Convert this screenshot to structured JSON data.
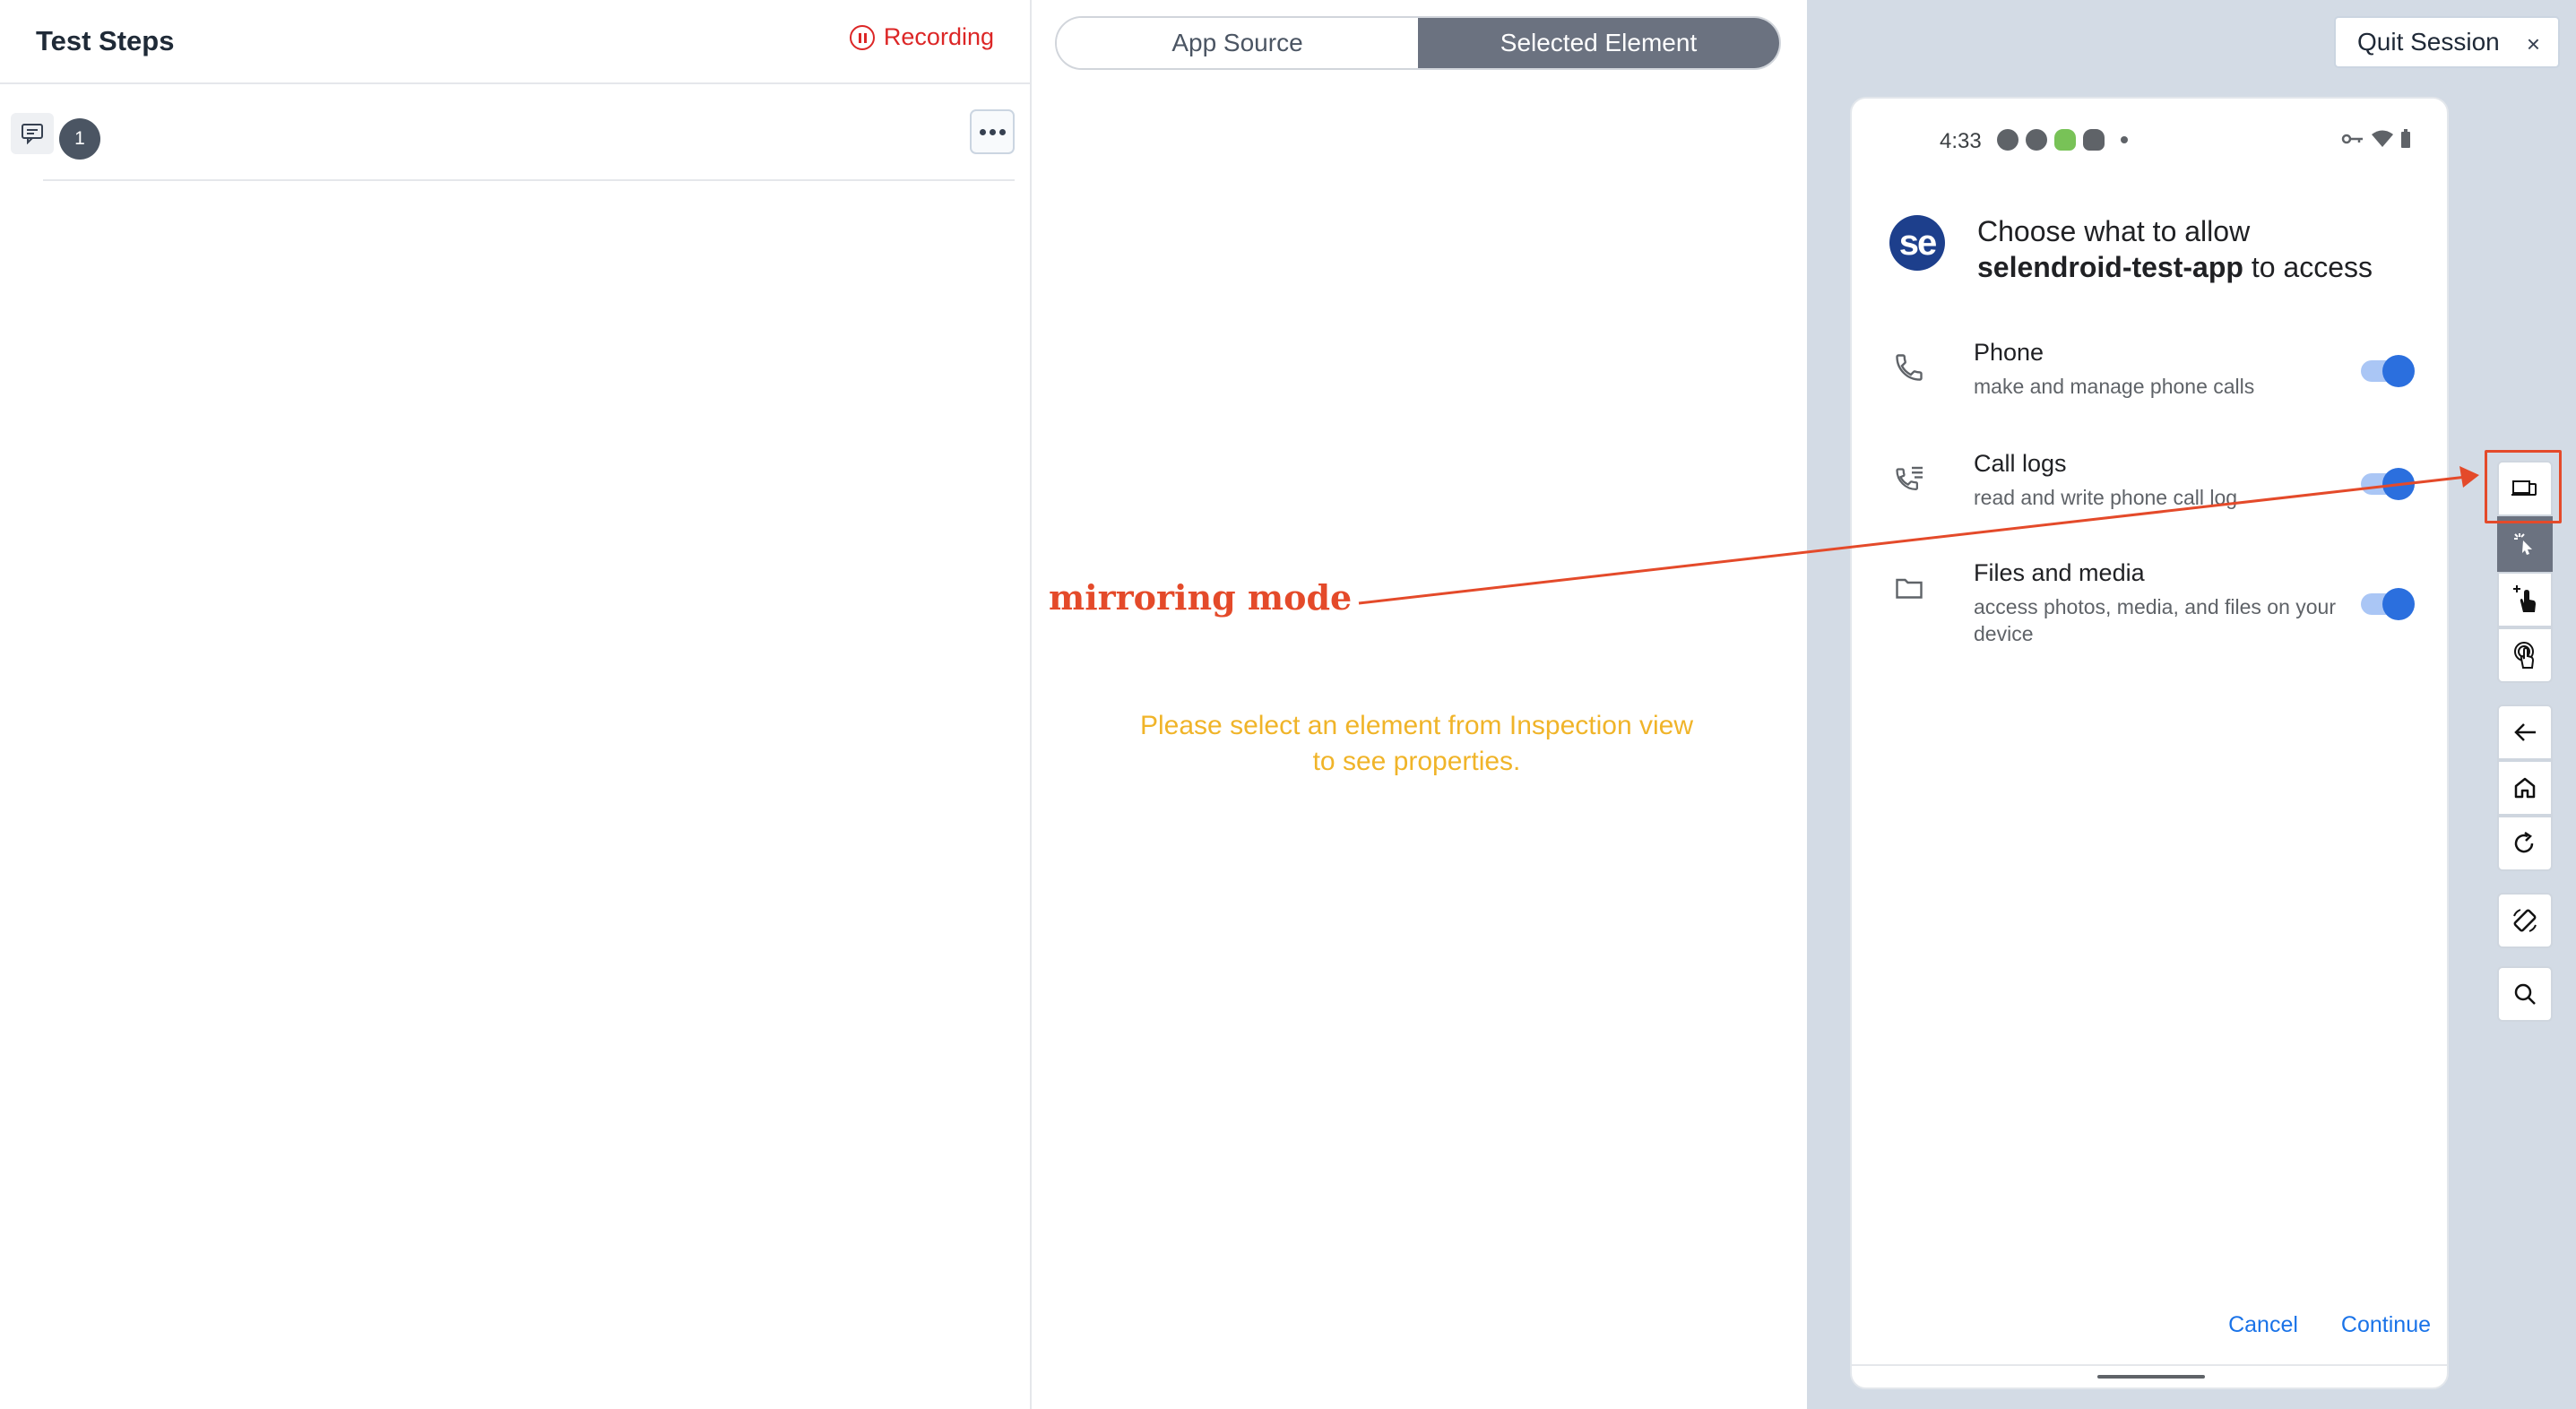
{
  "left_panel": {
    "title": "Test Steps",
    "recording_label": "Recording",
    "steps": [
      {
        "index": "1"
      }
    ]
  },
  "middle_panel": {
    "tabs": [
      {
        "label": "App Source",
        "active": false
      },
      {
        "label": "Selected Element",
        "active": true
      }
    ],
    "placeholder_line1": "Please select an element from Inspection view",
    "placeholder_line2": "to see properties."
  },
  "annotation": {
    "text": "mirroring mode",
    "color": "#e44a2a"
  },
  "right_panel": {
    "quit_label": "Quit Session",
    "quit_close": "×"
  },
  "device": {
    "status_time": "4:33",
    "app_logo_text": "se",
    "dialog_title_line1": "Choose what to allow",
    "dialog_app_name": "selendroid-test-app",
    "dialog_title_suffix": " to access",
    "permissions": [
      {
        "title": "Phone",
        "subtitle": "make and manage phone calls",
        "icon": "phone-icon",
        "enabled": true
      },
      {
        "title": "Call logs",
        "subtitle": "read and write phone call log",
        "icon": "call-log-icon",
        "enabled": true
      },
      {
        "title": "Files and media",
        "subtitle": "access photos, media, and files on your device",
        "icon": "folder-icon",
        "enabled": true
      }
    ],
    "cancel_label": "Cancel",
    "continue_label": "Continue"
  },
  "colors": {
    "accent_blue": "#1a73e8",
    "toggle_on": "#2b6fde",
    "recording_red": "#dc2626",
    "placeholder_yellow": "#f0b429",
    "active_tab": "#6b7280"
  },
  "toolbar": [
    "mirror-mode-icon",
    "select-element-icon",
    "tap-coordinates-icon",
    "gesture-icon",
    "back-icon",
    "home-icon",
    "refresh-icon",
    "rotate-icon",
    "search-icon"
  ]
}
